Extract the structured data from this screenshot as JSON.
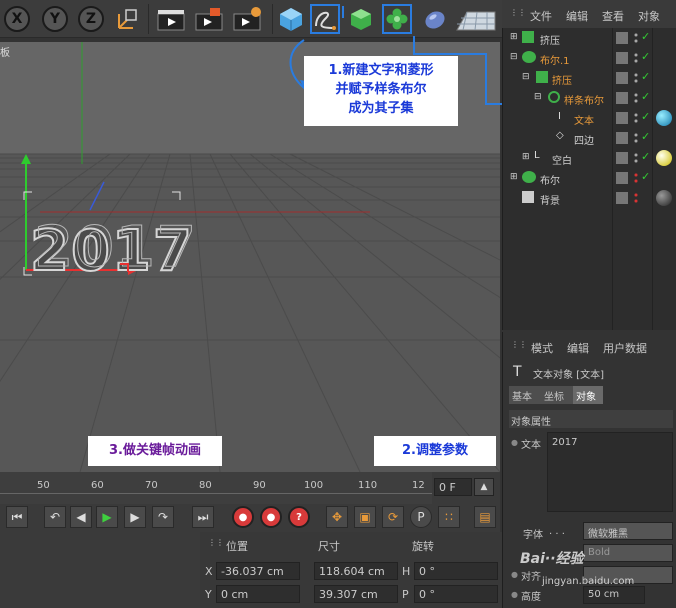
{
  "toolbar": {
    "axis_x": "X",
    "axis_y": "Y",
    "axis_z": "Z"
  },
  "viewport": {
    "title": "板",
    "model_text": "2017"
  },
  "callouts": {
    "step1_line1": "1.新建文字和菱形",
    "step1_line2": "并赋予样条布尔",
    "step1_line3": "成为其子集",
    "step2": "2.调整参数",
    "step3": "3.做关键帧动画"
  },
  "timeline": {
    "ticks": [
      "50",
      "60",
      "70",
      "80",
      "90",
      "100",
      "110",
      "12"
    ],
    "frame_field": "0 F"
  },
  "coords": {
    "header_position": "位置",
    "header_size": "尺寸",
    "header_rotation": "旋转",
    "row_x_label": "X",
    "row_x_position": "-36.037 cm",
    "row_x_size": "118.604 cm",
    "row_x_rot_label": "H",
    "row_x_rotation": "0 °",
    "row_y_label": "Y",
    "row_y_position": "0 cm",
    "row_y_size": "39.307 cm",
    "row_y_rot_label": "P",
    "row_y_rotation": "0 °"
  },
  "object_manager": {
    "menu": [
      "文件",
      "编辑",
      "查看",
      "对象"
    ],
    "rows": [
      {
        "name": "挤压",
        "color": "#d0d0d0"
      },
      {
        "name": "布尔.1",
        "color": "#e89a3a"
      },
      {
        "name": "挤压",
        "color": "#e89a3a"
      },
      {
        "name": "样条布尔",
        "color": "#e89a3a"
      },
      {
        "name": "文本",
        "color": "#e89a3a"
      },
      {
        "name": "四边",
        "color": "#d0d0d0"
      },
      {
        "name": "空白",
        "color": "#d0d0d0"
      },
      {
        "name": "布尔",
        "color": "#d0d0d0"
      },
      {
        "name": "背景",
        "color": "#d0d0d0"
      }
    ]
  },
  "attribute_manager": {
    "menu": [
      "模式",
      "编辑",
      "用户数据"
    ],
    "object_title": "文本对象 [文本]",
    "tabs": [
      "基本",
      "坐标",
      "对象"
    ],
    "section_title": "对象属性",
    "text_label": "文本",
    "text_value": "2017",
    "font_label": "字体",
    "font_value": "微软雅黑",
    "style_value": "Bold",
    "align_label": "对齐",
    "height_label": "高度",
    "height_value": "50 cm"
  },
  "watermark": {
    "line1": "Bai··经验",
    "line2": "jingyan.baidu.com"
  },
  "colors": {
    "highlight_blue": "#2a7ce0",
    "callout_text_blue": "#1b3ad8",
    "callout_text_purple": "#6a1b9a",
    "orange_active": "#e89a3a"
  }
}
